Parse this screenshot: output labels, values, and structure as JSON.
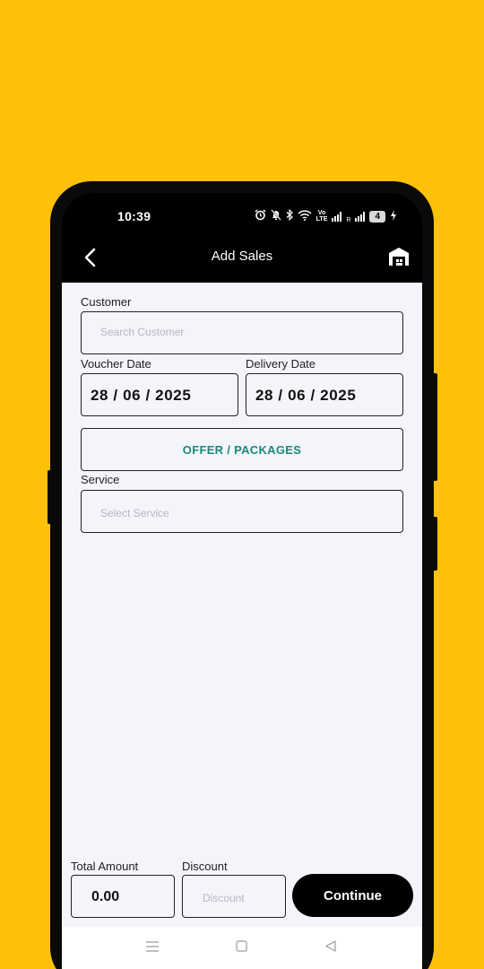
{
  "status_bar": {
    "time": "10:39",
    "volte_top": "Vo",
    "volte_bottom": "LTE",
    "roaming": "R",
    "battery": "4"
  },
  "app_bar": {
    "title": "Add Sales",
    "back_icon": "chevron-left-icon",
    "store_icon": "store-icon"
  },
  "form": {
    "customer_label": "Customer",
    "customer_placeholder": "Search Customer",
    "voucher_date_label": "Voucher Date",
    "voucher_date_value": "28 / 06 / 2025",
    "delivery_date_label": "Delivery Date",
    "delivery_date_value": "28 / 06 / 2025",
    "offer_button_label": "OFFER / PACKAGES",
    "service_label": "Service",
    "service_placeholder": "Select Service"
  },
  "footer": {
    "total_amount_label": "Total Amount",
    "total_amount_value": "0.00",
    "discount_label": "Discount",
    "discount_placeholder": "Discount",
    "continue_label": "Continue"
  },
  "colors": {
    "background": "#FFC107",
    "accent_text": "#1A8A7A",
    "screen_bg": "#F4F4FB"
  }
}
